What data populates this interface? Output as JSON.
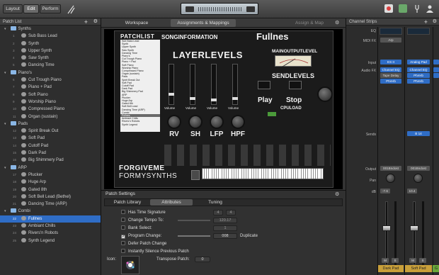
{
  "toolbar": {
    "layout": "Layout",
    "edit": "Edit",
    "perform": "Perform"
  },
  "patch_list": {
    "title": "Patch List",
    "groups": [
      {
        "name": "Synths",
        "items": [
          {
            "n": "1",
            "label": "Sub Bass Lead"
          },
          {
            "n": "2",
            "label": "Synth"
          },
          {
            "n": "3",
            "label": "Upper Synth"
          },
          {
            "n": "4",
            "label": "Saw Synth"
          },
          {
            "n": "5",
            "label": "Dancing Time"
          }
        ]
      },
      {
        "name": "Piano's",
        "items": [
          {
            "n": "6",
            "label": "Cut Trough Piano"
          },
          {
            "n": "7",
            "label": "Piano + Pad"
          },
          {
            "n": "8",
            "label": "Soft Piano"
          },
          {
            "n": "9",
            "label": "Worship Piano"
          },
          {
            "n": "10",
            "label": "Compressed Piano"
          },
          {
            "n": "11",
            "label": "Organ (sustain)"
          }
        ]
      },
      {
        "name": "Pads",
        "items": [
          {
            "n": "12",
            "label": "Spirit Break Out"
          },
          {
            "n": "13",
            "label": "Soft Pad"
          },
          {
            "n": "14",
            "label": "Cutoff Pad"
          },
          {
            "n": "15",
            "label": "Dark Pad"
          },
          {
            "n": "16",
            "label": "Big Shimmery Pad"
          }
        ]
      },
      {
        "name": "ARP",
        "items": [
          {
            "n": "17",
            "label": "Plucker"
          },
          {
            "n": "18",
            "label": "Huge Arp"
          },
          {
            "n": "19",
            "label": "Gated 8th"
          },
          {
            "n": "20",
            "label": "Soft Bell Lead (Bethel)"
          },
          {
            "n": "21",
            "label": "Dancing Time (ARP)"
          }
        ]
      },
      {
        "name": "Combi",
        "items": [
          {
            "n": "22",
            "label": "Fullnes"
          },
          {
            "n": "23",
            "label": "Ambiant Chills"
          },
          {
            "n": "24",
            "label": "Rivers'n Robots"
          },
          {
            "n": "25",
            "label": "Synth Legend"
          }
        ]
      }
    ]
  },
  "center": {
    "tab_workspace": "Workspace",
    "tab_assign": "Assignments & Mappings",
    "assign_map": "Assign & Map",
    "plugin": {
      "patchlist_title": "PATCHLIST",
      "song_info": "SONGINFORMATION",
      "song_name": "Fullnes",
      "layer_levels": "LAYERLEVELS",
      "main_output": "MAINOUTPUTLEVEL",
      "send_levels": "SENDLEVELS",
      "play": "Play",
      "stop": "Stop",
      "cpu": "CPULOAD",
      "volume": "Volume",
      "knobs": [
        "RV",
        "SH",
        "LFP",
        "HPF"
      ],
      "brand1": "FORGIVEME",
      "brand2": "FORMYSYNTHS",
      "mini_list": [
        "Sub Bass Lead",
        "Synth",
        "Upper Synth",
        "Saw Synth",
        "Dancing Time",
        "Piano's",
        "Cut Trough Piano",
        "Piano + Pad",
        "Soft Piano",
        "Worship Piano",
        "Compressed Piano",
        "Organ (sustain)",
        "Pads",
        "Spirit Break Out",
        "Soft Pad",
        "Cutoff Pad",
        "Dark Pad",
        "Big Shimmery Pad",
        "ARP",
        "Plucker",
        "Huge Arp",
        "Gated 8th",
        "Soft Bell Lead",
        "Dancing Time (ARP)",
        "Combi",
        "Fullnes",
        "Ambiant Chills",
        "Rivers'n Robots",
        "Synth Legend"
      ]
    }
  },
  "patch_settings": {
    "title": "Patch Settings",
    "tabs": [
      "Patch Library",
      "Attributes",
      "Tuning"
    ],
    "rows": {
      "has_time_sig": "Has Time Signature",
      "time_sig_num": "4",
      "time_sig_den": "4",
      "change_tempo": "Change Tempo To:",
      "tempo": "120.17",
      "bank_select": "Bank Select:",
      "bank": "1",
      "program_change": "Program Change:",
      "program": "008",
      "duplicate": "Duplicate",
      "defer": "Defer Patch Change",
      "silence": "Instantly Silence Previous Patch",
      "icon": "Icon:",
      "transpose": "Transpose Patch:",
      "transpose_val": "0"
    }
  },
  "channel_strips": {
    "title": "Channel Strips",
    "labels": {
      "eq": "EQ",
      "midi_fx": "MIDI FX",
      "input": "Input",
      "audio_fx": "Audio FX",
      "sends": "Sends",
      "output": "Output",
      "pan": "Pan",
      "db": "dB"
    },
    "strip1": {
      "midi_fx": "Arp",
      "input": "ES II",
      "fx": [
        "Channel EQ",
        "Tape Delay",
        "PtVerb"
      ],
      "send": "B 14",
      "output": "001Bndost",
      "db": "-7.6",
      "name": "Dark Pad"
    },
    "strip2": {
      "input": "Analog Pad",
      "fx": [
        "Channel EQ",
        "PtVerb",
        "PtVerb"
      ],
      "output": "001Bndost",
      "db": "10.4",
      "name": "Soft Pad"
    },
    "strip3": {
      "name": "G"
    },
    "ms": [
      "M",
      "S"
    ]
  },
  "colors": {
    "accent": "#2f6dc6",
    "record": "#d94040"
  }
}
